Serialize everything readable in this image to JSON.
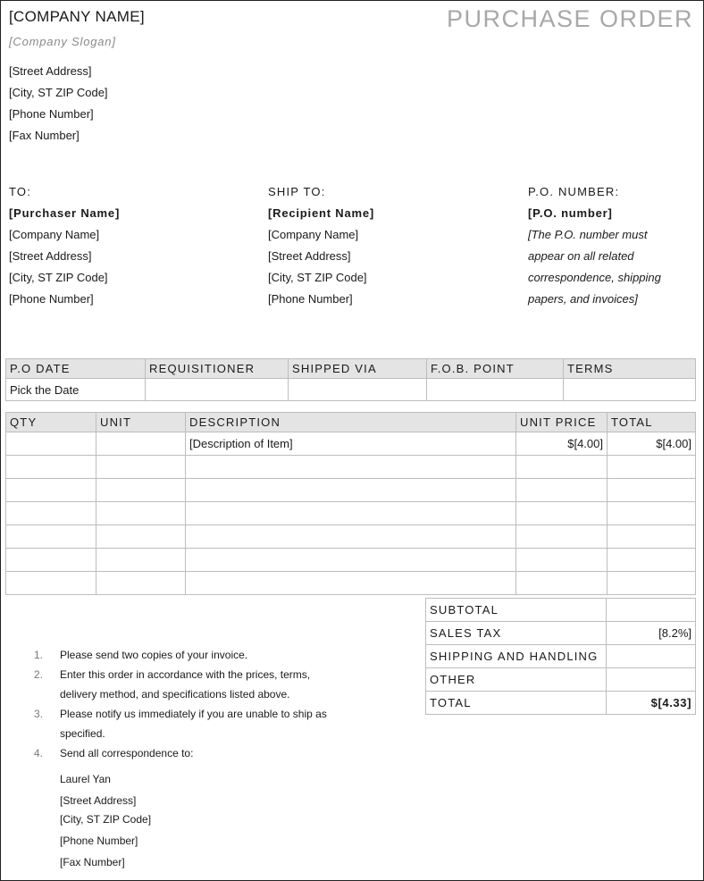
{
  "header": {
    "company_name": "[COMPANY NAME]",
    "slogan": "[Company Slogan]",
    "address_lines": [
      "[Street Address]",
      "[City, ST ZIP Code]",
      "[Phone Number]",
      "[Fax Number]"
    ],
    "title": "PURCHASE ORDER"
  },
  "to": {
    "label": "TO:",
    "name": "[Purchaser Name]",
    "lines": [
      "[Company Name]",
      "[Street Address]",
      "[City, ST  ZIP Code]",
      "[Phone Number]"
    ]
  },
  "ship_to": {
    "label": "SHIP TO:",
    "name": "[Recipient Name]",
    "lines": [
      "[Company Name]",
      "[Street Address]",
      "[City, ST  ZIP Code]",
      "[Phone Number]"
    ]
  },
  "po": {
    "label": "P.O. NUMBER:",
    "number": "[P.O. number]",
    "note_lines": [
      "[The P.O. number must",
      "appear on all related",
      "correspondence, shipping",
      "papers, and invoices]"
    ]
  },
  "info_table": {
    "headers": [
      "P.O DATE",
      "REQUISITIONER",
      "SHIPPED VIA",
      "F.O.B. POINT",
      "TERMS"
    ],
    "values": [
      "Pick the Date",
      "",
      "",
      "",
      ""
    ]
  },
  "items_table": {
    "headers": [
      "QTY",
      "UNIT",
      "DESCRIPTION",
      "UNIT PRICE",
      "TOTAL"
    ],
    "rows": [
      [
        "",
        "",
        "[Description of Item]",
        "$[4.00]",
        "$[4.00]"
      ],
      [
        "",
        "",
        "",
        "",
        ""
      ],
      [
        "",
        "",
        "",
        "",
        ""
      ],
      [
        "",
        "",
        "",
        "",
        ""
      ],
      [
        "",
        "",
        "",
        "",
        ""
      ],
      [
        "",
        "",
        "",
        "",
        ""
      ],
      [
        "",
        "",
        "",
        "",
        ""
      ]
    ]
  },
  "totals": [
    {
      "label": "SUBTOTAL",
      "value": ""
    },
    {
      "label": "SALES TAX",
      "value": "[8.2%]"
    },
    {
      "label": "SHIPPING AND HANDLING",
      "value": ""
    },
    {
      "label": "OTHER",
      "value": ""
    },
    {
      "label": "TOTAL",
      "value": "$[4.33]"
    }
  ],
  "notes": [
    {
      "num": "1.",
      "text": "Please send two copies of your invoice."
    },
    {
      "num": "2.",
      "text": "Enter this order in accordance with the prices, terms, delivery method, and specifications listed above."
    },
    {
      "num": "3.",
      "text": "Please notify us immediately if you are unable to ship as specified."
    },
    {
      "num": "4.",
      "text": "Send all correspondence to:"
    }
  ],
  "contact": {
    "name": "Laurel Yan",
    "lines": [
      "[Street Address]",
      "[City, ST ZIP Code]",
      "[Phone Number]",
      "[Fax Number]"
    ]
  }
}
